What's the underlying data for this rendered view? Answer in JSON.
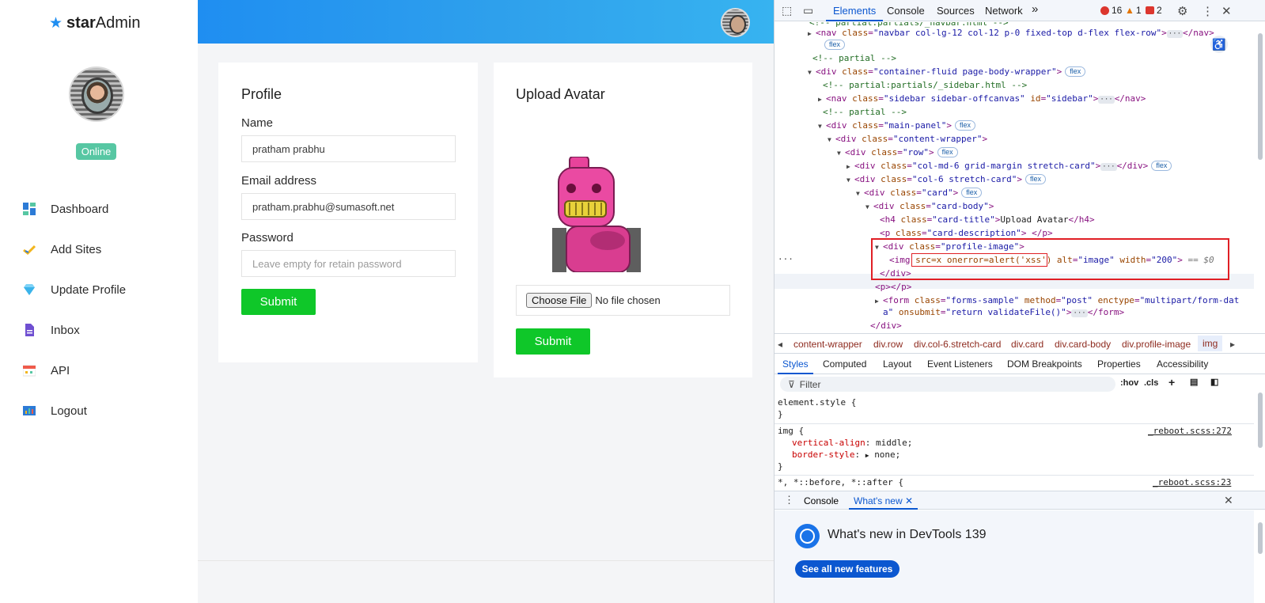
{
  "sidebar": {
    "brand_prefix": "star",
    "brand_suffix": "Admin",
    "status": "Online",
    "items": [
      {
        "label": "Dashboard"
      },
      {
        "label": "Add Sites"
      },
      {
        "label": "Update Profile"
      },
      {
        "label": "Inbox"
      },
      {
        "label": "API"
      },
      {
        "label": "Logout"
      }
    ]
  },
  "profile": {
    "title": "Profile",
    "name_label": "Name",
    "name_value": "pratham prabhu",
    "email_label": "Email address",
    "email_value": "pratham.prabhu@sumasoft.net",
    "password_label": "Password",
    "password_placeholder": "Leave empty for retain password",
    "submit_label": "Submit"
  },
  "upload": {
    "title": "Upload Avatar",
    "choose_label": "Choose File",
    "file_status": "No file chosen",
    "submit_label": "Submit"
  },
  "devtools": {
    "tabs": [
      "Elements",
      "Console",
      "Sources",
      "Network"
    ],
    "more": "»",
    "errors": "16",
    "warnings": "1",
    "issues": "2",
    "breadcrumbs": [
      "content-wrapper",
      "div.row",
      "div.col-6.stretch-card",
      "div.card",
      "div.card-body",
      "div.profile-image",
      "img"
    ],
    "subtabs": [
      "Styles",
      "Computed",
      "Layout",
      "Event Listeners",
      "DOM Breakpoints",
      "Properties",
      "Accessibility"
    ],
    "filter_placeholder": "Filter",
    "hov": ":hov",
    "cls": ".cls",
    "styles": {
      "element_style": "element.style {",
      "close": "}",
      "img_rule": "img {",
      "img_src": "_reboot.scss:272",
      "prop1_name": "vertical-align",
      "prop1_value": "middle;",
      "prop2_name": "border-style",
      "prop2_value": "none;",
      "star_rule": "*, *::before, *::after {",
      "star_src": "_reboot.scss:23"
    },
    "drawer_tabs": [
      "Console",
      "What's new"
    ],
    "whatsnew_title": "What's new in DevTools 139",
    "whatsnew_button": "See all new features",
    "tree": {
      "l0": "<!-- partial:partials/_navbar.html -->",
      "l1_tag": "<nav ",
      "l1_attr": "class",
      "l1_val": "\"navbar col-lg-12 col-12 p-0 fixed-top d-flex flex-row\"",
      "l1_end": "</nav>",
      "pill_flex": "flex",
      "l2": "<!-- partial -->",
      "l3_tag": "<div ",
      "l3_val": "\"container-fluid page-body-wrapper\"",
      "l4": "<!-- partial:partials/_sidebar.html -->",
      "l5_val": "\"sidebar sidebar-offcanvas\"",
      "l5_id": "id",
      "l5_idval": "\"sidebar\"",
      "l6": "<!-- partial -->",
      "l7_val": "\"main-panel\"",
      "l8_val": "\"content-wrapper\"",
      "l9_val": "\"row\"",
      "l10_val": "\"col-md-6 grid-margin stretch-card\"",
      "l11_val": "\"col-6 stretch-card\"",
      "l12_val": "\"card\"",
      "l13_val": "\"card-body\"",
      "l14_val": "\"card-title\"",
      "l14_text": "Upload Avatar",
      "l15_val": "\"card-description\"",
      "l16_val": "\"profile-image\"",
      "l17_attr": "src=x onerror=alert('xss')",
      "l17_alt": "\"image\"",
      "l17_width": "\"200\"",
      "l17_dollar": "== $0",
      "l18": "</div>",
      "l19": "<p></p>",
      "l20_val": "\"forms-sample\"",
      "l20_method": "\"post\"",
      "l20_enctype": "\"multipart/form-dat",
      "l21_cont": "a\"",
      "l21_onsubmit": "\"return validateFile()\"",
      "l22": "</div>"
    }
  }
}
